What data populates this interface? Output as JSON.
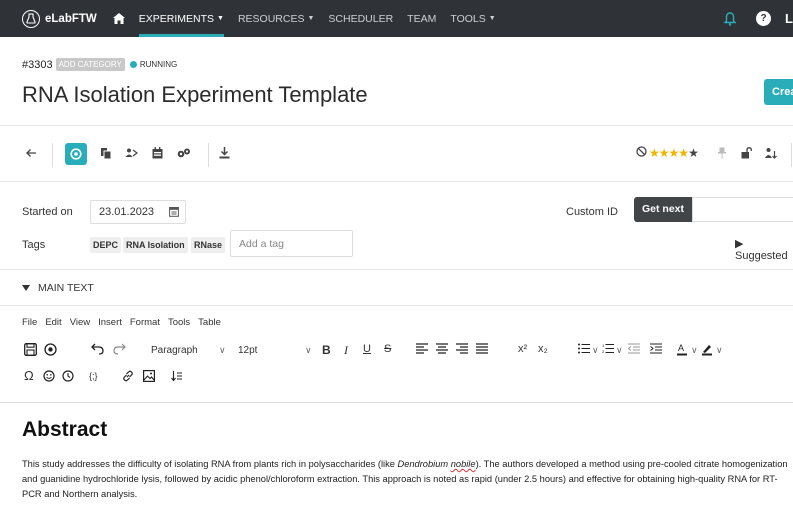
{
  "nav": {
    "brand": "eLabFTW",
    "items": [
      {
        "label": "EXPERIMENTS",
        "caret": true,
        "active": true
      },
      {
        "label": "RESOURCES",
        "caret": true,
        "active": false
      },
      {
        "label": "SCHEDULER",
        "caret": false,
        "active": false
      },
      {
        "label": "TEAM",
        "caret": false,
        "active": false
      },
      {
        "label": "TOOLS",
        "caret": true,
        "active": false
      }
    ],
    "help_glyph": "?",
    "user_initial": "L"
  },
  "header": {
    "id": "#3303",
    "category_badge": "ADD CATEGORY",
    "status": "RUNNING",
    "title": "RNA Isolation Experiment Template",
    "create_label": "Crea"
  },
  "fields": {
    "started_label": "Started on",
    "date": "23.01.2023",
    "custom_id_label": "Custom ID",
    "get_next_label": "Get next",
    "tags_label": "Tags",
    "tags": [
      "DEPC",
      "RNA Isolation",
      "RNase"
    ],
    "add_tag_placeholder": "Add a tag",
    "suggested_label": "▶ Suggested"
  },
  "main_text": {
    "label": "MAIN TEXT"
  },
  "editor": {
    "menu": [
      "File",
      "Edit",
      "View",
      "Insert",
      "Format",
      "Tools",
      "Table"
    ],
    "block_format": "Paragraph",
    "font_size": "12pt"
  },
  "content": {
    "heading": "Abstract",
    "p1": "This study addresses the difficulty of isolating RNA from plants rich in polysaccharides (like ",
    "species": "Dendrobium",
    "species2": "nobile",
    "p2": "). The authors developed a method using pre-cooled citrate homogenization and guanidine hydrochloride lysis, followed by acidic phenol/chloroform extraction. This approach is noted as rapid (under 2.5 hours) and effective for obtaining high-quality RNA for RT-PCR and Northern analysis."
  },
  "colors": {
    "nav_bg": "#2f3236",
    "accent": "#29aeb9",
    "star": "#f0b400"
  }
}
